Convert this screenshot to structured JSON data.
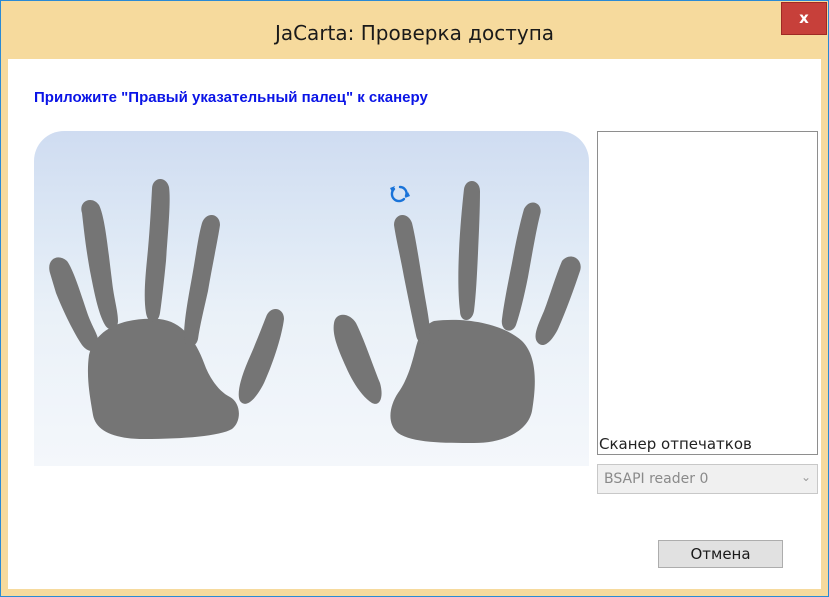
{
  "window": {
    "title": "JaCarta: Проверка доступа",
    "close_label": "x"
  },
  "instruction": "Приложите \"Правый указательный палец\" к сканеру",
  "fingers": {
    "left_hand": [
      "left-pinky",
      "left-ring",
      "left-middle",
      "left-index",
      "left-thumb"
    ],
    "right_hand": [
      "right-thumb",
      "right-index",
      "right-middle",
      "right-ring",
      "right-pinky"
    ],
    "active_finger": "right-index",
    "active_indicator_icon": "refresh-icon"
  },
  "scanner": {
    "label": "Сканер отпечатков",
    "selected": "BSAPI reader 0"
  },
  "buttons": {
    "cancel": "Отмена"
  },
  "colors": {
    "titlebar": "#f6da9d",
    "close": "#c7403a",
    "instruction": "#0a14e6",
    "hand": "#757575",
    "indicator": "#1a73d9"
  }
}
